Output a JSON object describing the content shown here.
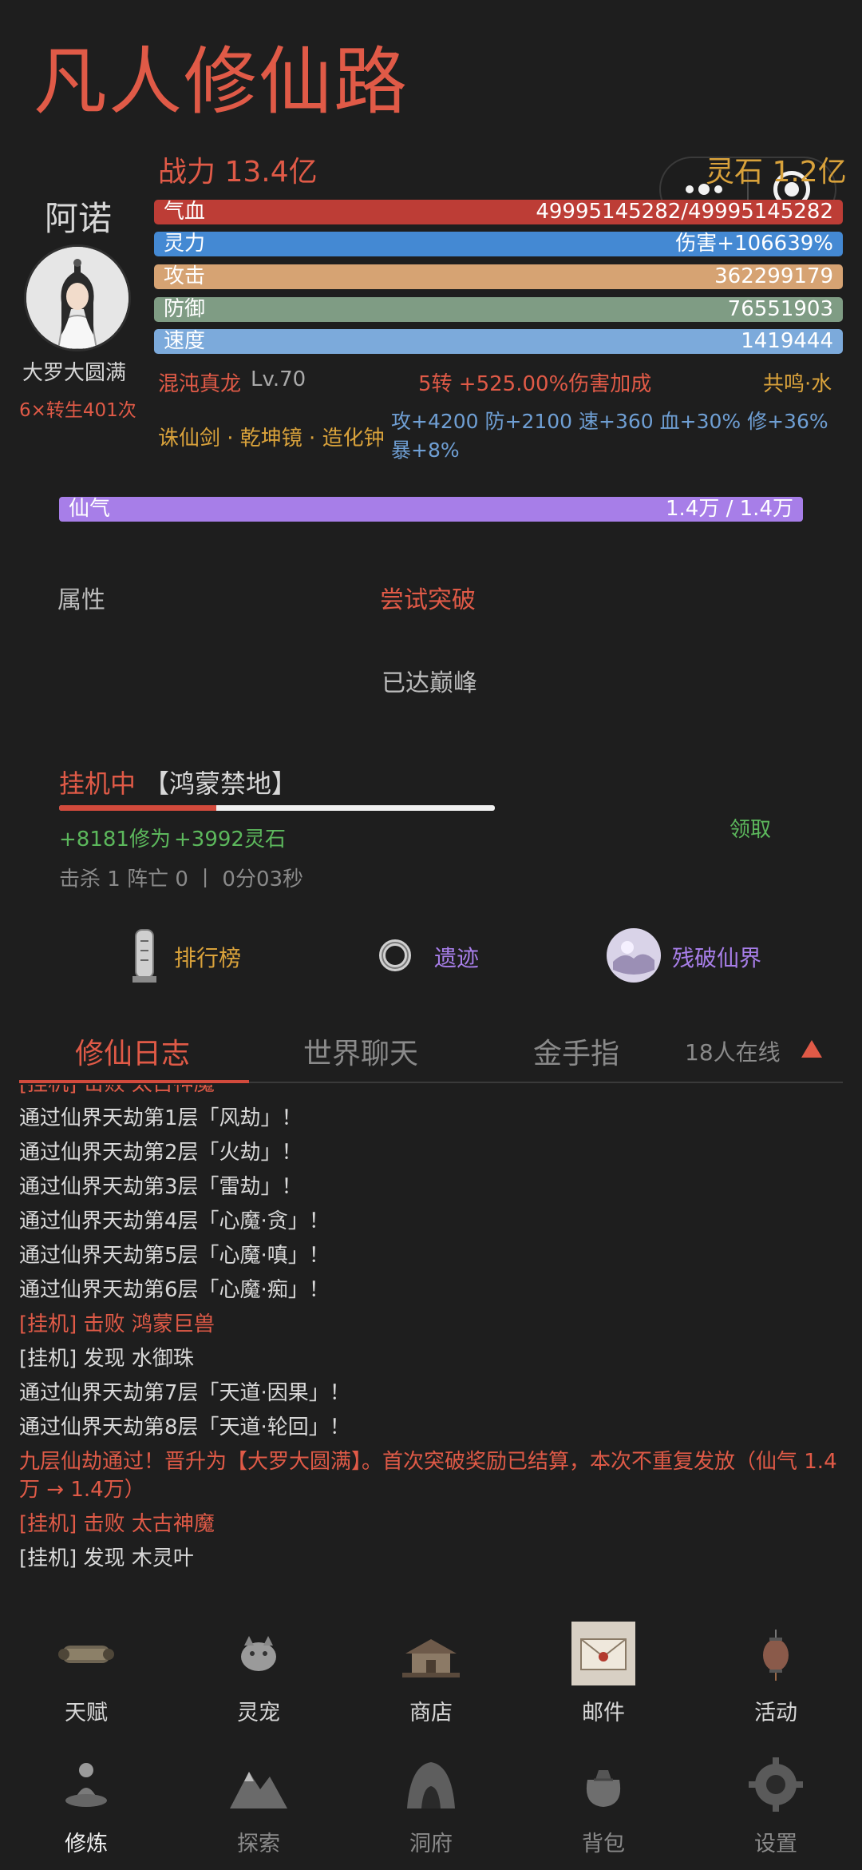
{
  "app": {
    "title": "凡人修仙路"
  },
  "header": {
    "power": "战力 13.4亿",
    "spirit_stone": "灵石 1.2亿"
  },
  "character": {
    "name": "阿诺",
    "realm": "大罗大圆满",
    "rebirth": "6×转生401次"
  },
  "stats": {
    "hp": {
      "label": "气血",
      "value": "4999514528​2/4999514528​2"
    },
    "sp": {
      "label": "灵力",
      "value": "伤害+106639%"
    },
    "atk": {
      "label": "攻击",
      "value": "362299179"
    },
    "def": {
      "label": "防御",
      "value": "76551903"
    },
    "spd": {
      "label": "速度",
      "value": "1419444"
    }
  },
  "pet": {
    "name": "混沌真龙",
    "level": "Lv.70",
    "bonus": "5转 +525.00%伤害加成",
    "resonance": "共鸣·水"
  },
  "treasures": {
    "names": "诛仙剑 · 乾坤镜 · 造化钟",
    "stats": "攻+4200 防+2100 速+360 血+30% 修+36% 暴+8%"
  },
  "qi": {
    "label": "仙气",
    "value": "1.4万 / 1.4万",
    "fill_fraction": 1.0
  },
  "cultivation": {
    "attr_label": "属性",
    "breakthrough_label": "尝试突破",
    "status": "已达巅峰"
  },
  "idle": {
    "label": "挂机中",
    "location": "【鸿蒙禁地】",
    "progress_fraction": 0.36,
    "gain_xiuwei": "+8181修为",
    "gain_stone": "+3992灵石",
    "claim_label": "领取",
    "kill_info": "击杀 1  阵亡 0 丨 0分03秒"
  },
  "quick_links": [
    {
      "label": "排行榜",
      "icon": "stele-icon",
      "color": "#d9a23b"
    },
    {
      "label": "遗迹",
      "icon": "ring-icon",
      "color": "#a77ee8"
    },
    {
      "label": "残破仙界",
      "icon": "broken-realm-icon",
      "color": "#a77ee8"
    }
  ],
  "tabs": [
    {
      "label": "修仙日志",
      "active": true
    },
    {
      "label": "世界聊天",
      "active": false
    },
    {
      "label": "金手指",
      "active": false
    }
  ],
  "online": "18人在线",
  "log": [
    {
      "text": "[挂机] 击败 太古神魔",
      "style": "red"
    },
    {
      "text": "通过仙界天劫第1层「风劫」！",
      "style": "normal"
    },
    {
      "text": "通过仙界天劫第2层「火劫」！",
      "style": "normal"
    },
    {
      "text": "通过仙界天劫第3层「雷劫」！",
      "style": "normal"
    },
    {
      "text": "通过仙界天劫第4层「心魔·贪」！",
      "style": "normal"
    },
    {
      "text": "通过仙界天劫第5层「心魔·嗔」！",
      "style": "normal"
    },
    {
      "text": "通过仙界天劫第6层「心魔·痴」！",
      "style": "normal"
    },
    {
      "text": "[挂机] 击败 鸿蒙巨兽",
      "style": "red"
    },
    {
      "text": "[挂机] 发现 水御珠",
      "style": "normal"
    },
    {
      "text": "通过仙界天劫第7层「天道·因果」！",
      "style": "normal"
    },
    {
      "text": "通过仙界天劫第8层「天道·轮回」！",
      "style": "normal"
    },
    {
      "text": "九层仙劫通过！晋升为【大罗大圆满】。首次突破奖励已结算，本次不重复发放（仙气 1.4万 → 1.4万）",
      "style": "red-wrap"
    },
    {
      "text": "[挂机] 击败 太古神魔",
      "style": "red"
    },
    {
      "text": "[挂机] 发现 木灵叶",
      "style": "normal"
    }
  ],
  "nav_row1": [
    {
      "label": "天赋",
      "icon": "scroll-icon"
    },
    {
      "label": "灵宠",
      "icon": "pet-icon"
    },
    {
      "label": "商店",
      "icon": "shop-icon"
    },
    {
      "label": "邮件",
      "icon": "mail-icon"
    },
    {
      "label": "活动",
      "icon": "lantern-icon"
    }
  ],
  "nav_row2": [
    {
      "label": "修炼",
      "icon": "meditate-icon",
      "active": true
    },
    {
      "label": "探索",
      "icon": "mountain-icon",
      "active": false
    },
    {
      "label": "洞府",
      "icon": "cave-icon",
      "active": false
    },
    {
      "label": "背包",
      "icon": "bag-icon",
      "active": false
    },
    {
      "label": "设置",
      "icon": "gear-icon",
      "active": false
    }
  ],
  "colors": {
    "accent_red": "#e05a47",
    "gold": "#d9a23b",
    "green": "#5cb85c",
    "purple": "#a77ee8",
    "background": "#1e1e1e"
  }
}
